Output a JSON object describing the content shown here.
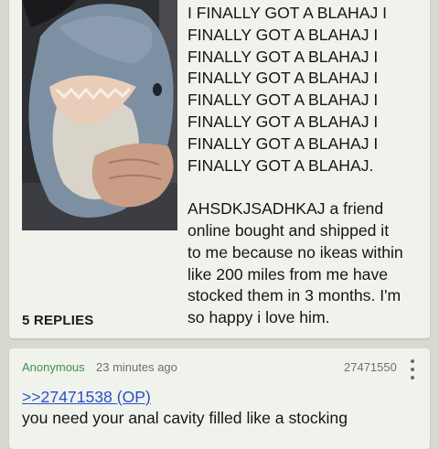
{
  "post": {
    "image_alt": "photo of a person hugging a blue shark plush",
    "body_lines": [
      "I FINALLY GOT A BLAHAJ I",
      "FINALLY GOT A BLAHAJ I",
      "FINALLY GOT A BLAHAJ I",
      "FINALLY GOT A BLAHAJ I",
      "FINALLY GOT A BLAHAJ I",
      "FINALLY GOT A BLAHAJ I",
      "FINALLY GOT A BLAHAJ I",
      "FINALLY GOT A BLAHAJ."
    ],
    "body_para2_lines": [
      "AHSDKJSADHKAJ a friend",
      "online bought and shipped it",
      "to me because no ikeas within",
      "like 200 miles from me have",
      "stocked them in 3 months. I'm",
      "so happy i love him."
    ],
    "replies_label": "5 REPLIES"
  },
  "reply": {
    "name": "Anonymous",
    "time": "23 minutes ago",
    "post_id": "27471550",
    "quote": ">>27471538 (OP)",
    "text": "you need your anal cavity filled like a stocking"
  },
  "colors": {
    "page_bg": "#d6dad0",
    "card_bg": "#f0f3ec",
    "name_green": "#3f8f4f",
    "link_blue": "#2a4fc7"
  },
  "icons": {
    "reply_menu": "more-vertical-icon"
  }
}
